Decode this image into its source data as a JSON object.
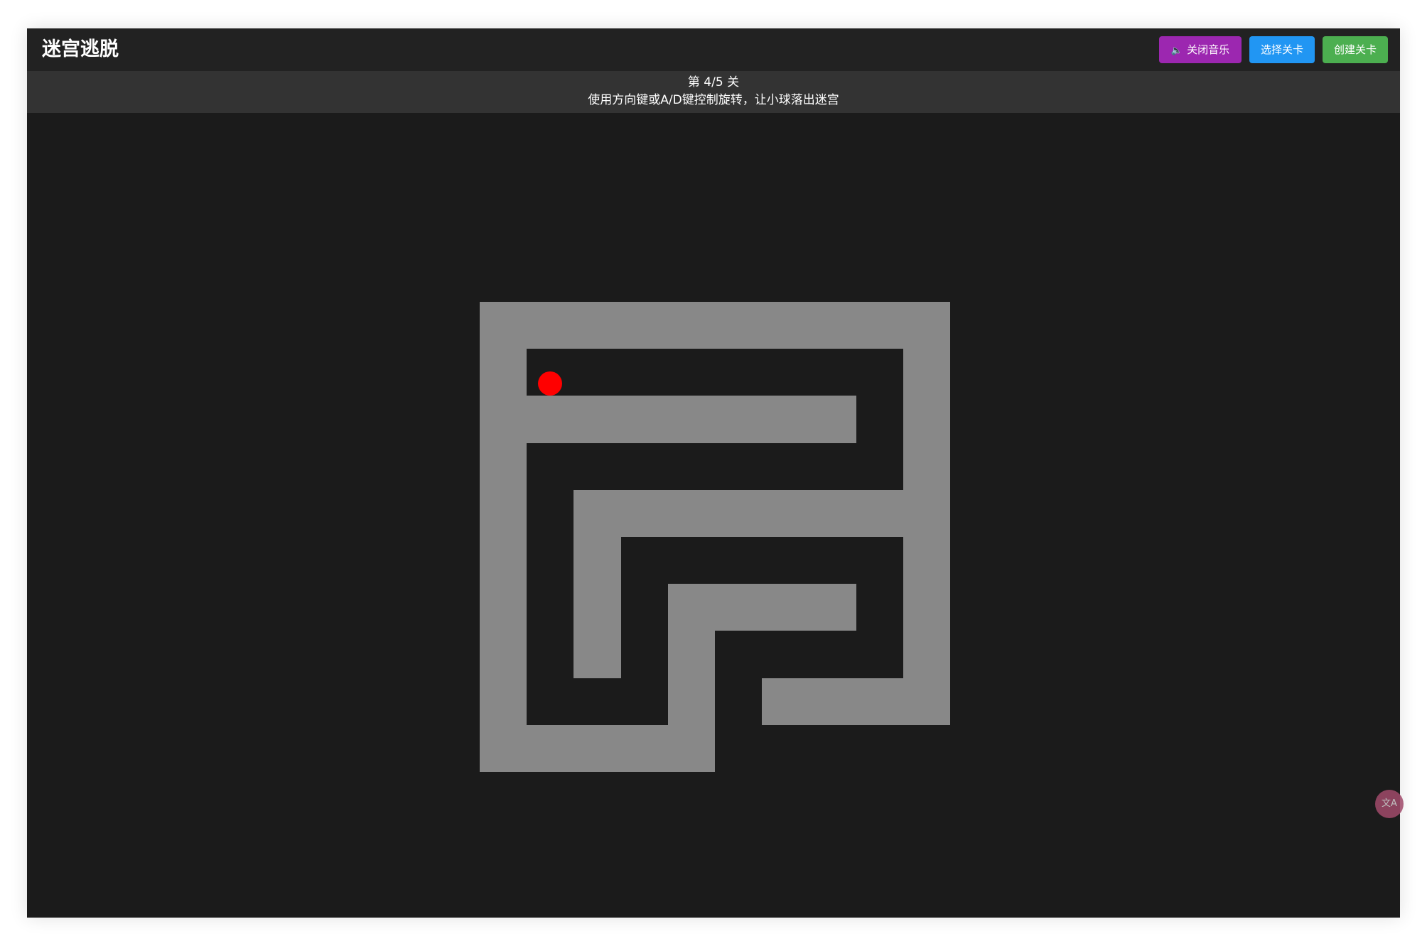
{
  "header": {
    "title": "迷宫逃脱",
    "buttons": {
      "music": "关闭音乐",
      "select_level": "选择关卡",
      "create_level": "创建关卡"
    }
  },
  "info": {
    "level": "第 4/5 关",
    "instructions": "使用方向键或A/D键控制旋转，让小球落出迷宫"
  },
  "colors": {
    "wall": "#888888",
    "ball": "#ff0000",
    "background": "#1b1b1b",
    "music_button": "#9c27b0",
    "select_button": "#2196f3",
    "create_button": "#4caf50"
  },
  "icons": {
    "music": "speaker-icon",
    "translate": "translate-icon"
  },
  "maze": {
    "rows": 10,
    "cols": 10,
    "grid": [
      [
        1,
        1,
        1,
        1,
        1,
        1,
        1,
        1,
        1,
        1
      ],
      [
        1,
        0,
        0,
        0,
        0,
        0,
        0,
        0,
        0,
        1
      ],
      [
        1,
        1,
        1,
        1,
        1,
        1,
        1,
        1,
        0,
        1
      ],
      [
        1,
        0,
        0,
        0,
        0,
        0,
        0,
        0,
        0,
        1
      ],
      [
        1,
        0,
        1,
        1,
        1,
        1,
        1,
        1,
        1,
        1
      ],
      [
        1,
        0,
        1,
        0,
        0,
        0,
        0,
        0,
        0,
        1
      ],
      [
        1,
        0,
        1,
        0,
        1,
        1,
        1,
        1,
        0,
        1
      ],
      [
        1,
        0,
        1,
        0,
        1,
        0,
        0,
        0,
        0,
        1
      ],
      [
        1,
        0,
        0,
        0,
        1,
        0,
        1,
        1,
        1,
        1
      ],
      [
        1,
        1,
        1,
        1,
        1,
        0,
        0,
        0,
        0,
        0
      ]
    ],
    "ball": {
      "row": 1,
      "col": 1
    }
  }
}
